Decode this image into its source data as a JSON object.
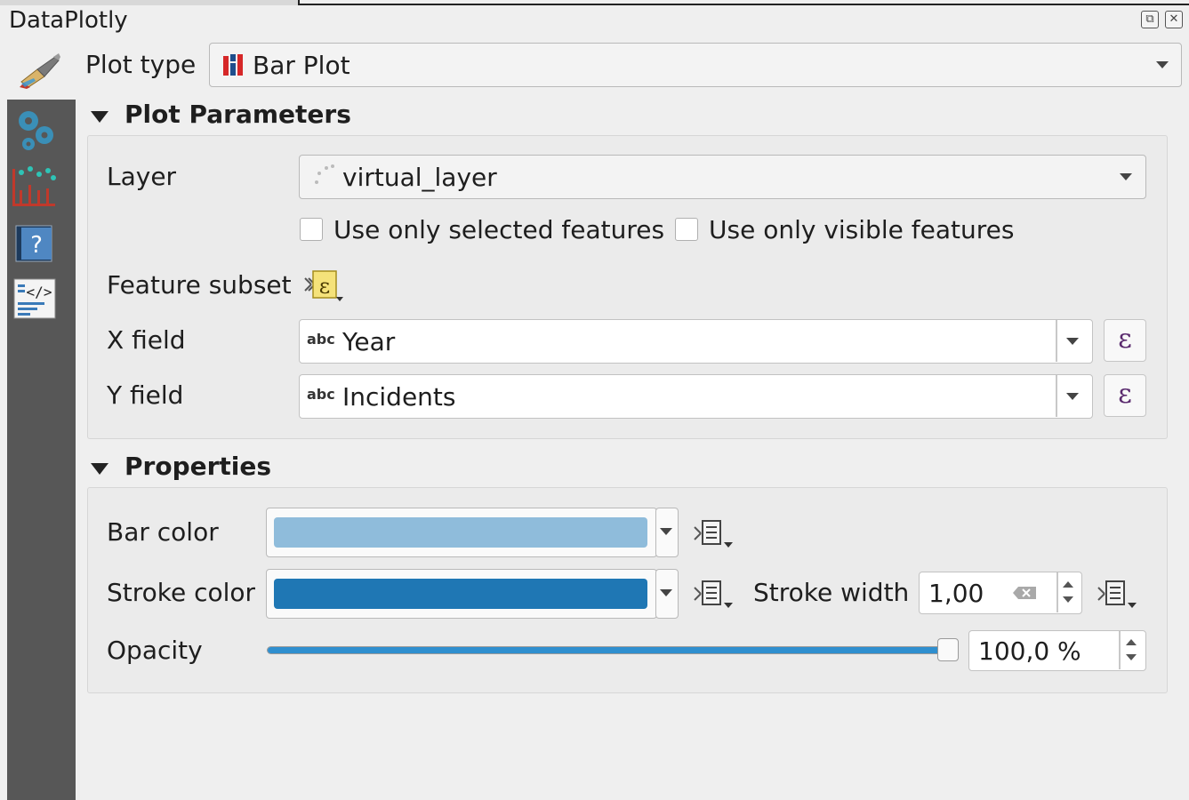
{
  "window": {
    "title": "DataPlotly"
  },
  "plot_type": {
    "label": "Plot type",
    "value": "Bar Plot"
  },
  "plot_parameters": {
    "title": "Plot Parameters",
    "layer_label": "Layer",
    "layer_value": "virtual_layer",
    "use_selected_label": "Use only selected features",
    "use_visible_label": "Use only visible features",
    "feature_subset_label": "Feature subset",
    "x_field_label": "X field",
    "x_field_type": "abc",
    "x_field_value": "Year",
    "y_field_label": "Y field",
    "y_field_type": "abc",
    "y_field_value": "Incidents",
    "epsilon_symbol": "ε"
  },
  "properties": {
    "title": "Properties",
    "bar_color_label": "Bar color",
    "bar_color": "#8fbcdb",
    "stroke_color_label": "Stroke color",
    "stroke_color": "#1f77b4",
    "stroke_width_label": "Stroke width",
    "stroke_width_value": "1,00",
    "opacity_label": "Opacity",
    "opacity_value": "100,0 %",
    "opacity_fraction": 1.0
  },
  "icons": {
    "dock_float": "float-icon",
    "dock_close": "close-icon",
    "plot_type": "bar-plot-icon",
    "sidebar": [
      "settings-gears-icon",
      "plot-scatter-bars-icon",
      "help-icon",
      "code-icon"
    ]
  }
}
